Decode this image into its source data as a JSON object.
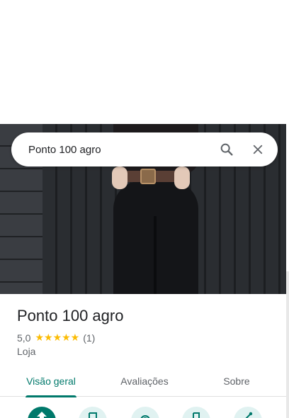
{
  "search": {
    "query": "Ponto 100 agro"
  },
  "place": {
    "name": "Ponto 100 agro",
    "rating": "5,0",
    "stars": "★★★★★",
    "review_count": "(1)",
    "category": "Loja"
  },
  "tabs": [
    {
      "label": "Visão geral",
      "selected": true
    },
    {
      "label": "Avaliações",
      "selected": false
    },
    {
      "label": "Sobre",
      "selected": false
    }
  ],
  "colors": {
    "accent": "#00796b",
    "accent_light": "#e0f2f1",
    "star": "#fbbc04"
  },
  "icons": {
    "search": "search-icon",
    "close": "close-icon",
    "actions": [
      "directions-icon",
      "save-icon",
      "nearby-icon",
      "phone-icon",
      "share-icon"
    ]
  }
}
